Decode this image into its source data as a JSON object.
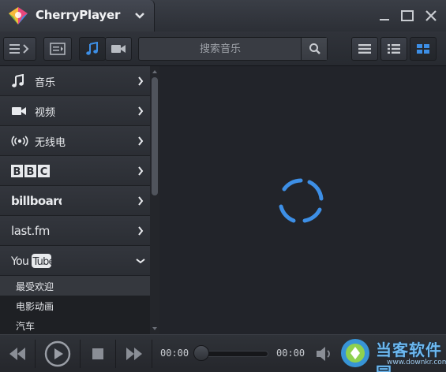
{
  "window": {
    "title": "CherryPlayer"
  },
  "toolbar": {
    "search_placeholder": "搜索音乐"
  },
  "sidebar": {
    "items": [
      {
        "label": "音乐",
        "icon": "music-note-icon"
      },
      {
        "label": "视频",
        "icon": "video-camera-icon"
      },
      {
        "label": "无线电",
        "icon": "radio-broadcast-icon"
      },
      {
        "label": "BBC",
        "icon": "bbc-logo"
      },
      {
        "label": "billboard",
        "icon": "billboard-logo"
      },
      {
        "label": "last.fm",
        "icon": "lastfm-logo"
      },
      {
        "label": "YouTube",
        "icon": "youtube-logo"
      }
    ],
    "youtube_sub": [
      {
        "label": "最受欢迎",
        "selected": true
      },
      {
        "label": "电影动画",
        "selected": false
      },
      {
        "label": "汽车",
        "selected": false
      }
    ]
  },
  "player": {
    "elapsed": "00:00",
    "total": "00:00"
  },
  "watermark": {
    "text": "当客软件园",
    "url": "www.downkr.com"
  },
  "colors": {
    "accent": "#3d8fe6",
    "background": "#22242a"
  }
}
